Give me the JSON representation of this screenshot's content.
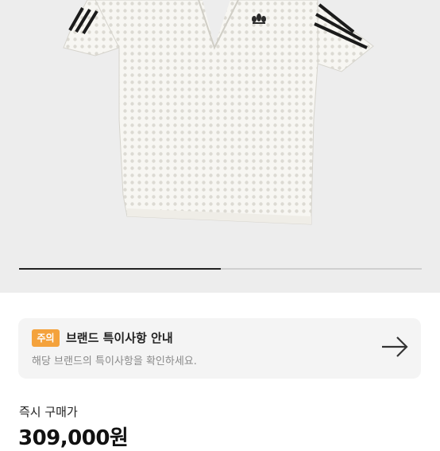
{
  "gallery": {
    "image": "white-crochet-polo-shirt-with-black-stripes",
    "slide_progress": 0.5
  },
  "notice": {
    "badge": "주의",
    "title": "브랜드 특이사항 안내",
    "description": "해당 브랜드의 특이사항을 확인하세요.",
    "arrow_icon": "arrow-right-icon",
    "badge_color": "#f4a23c"
  },
  "price": {
    "label": "즉시 구매가",
    "value": "309,000원"
  }
}
